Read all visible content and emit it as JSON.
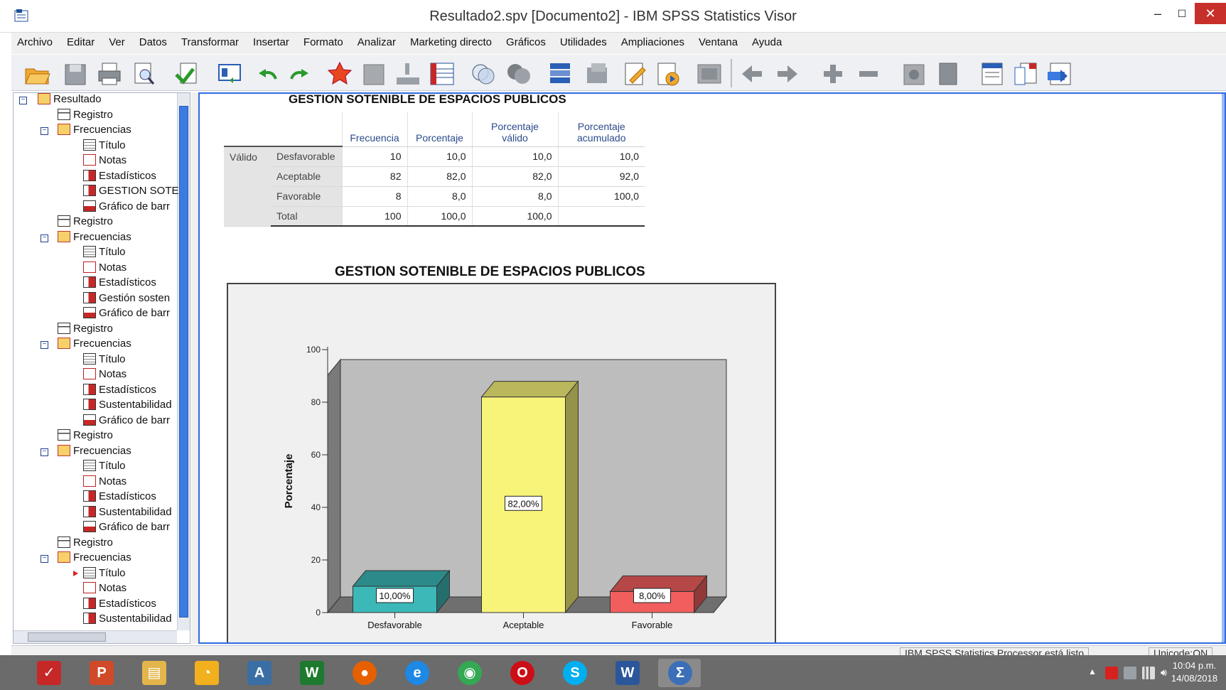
{
  "window": {
    "title": "Resultado2.spv [Documento2] - IBM SPSS Statistics Visor"
  },
  "menu": [
    "Archivo",
    "Editar",
    "Ver",
    "Datos",
    "Transformar",
    "Insertar",
    "Formato",
    "Analizar",
    "Marketing directo",
    "Gráficos",
    "Utilidades",
    "Ampliaciones",
    "Ventana",
    "Ayuda"
  ],
  "toolbar_icons": [
    "open-icon",
    "save-icon",
    "print-icon",
    "print-preview-icon",
    "export-icon",
    "recall-dialog-icon",
    "undo-icon",
    "redo-icon",
    "goto-data-icon",
    "goto-case-icon",
    "goto-variable-icon",
    "variables-icon",
    "run-descriptives-icon",
    "use-variable-sets-icon",
    "show-all-variables-icon",
    "spell-check-icon",
    "select-last-output-icon",
    "designate-window-icon",
    "create-edit-autoscript-icon",
    "run-script-icon",
    "outline-promote-icon",
    "outline-demote-icon",
    "expand-icon",
    "collapse-icon",
    "show-icon",
    "hide-icon",
    "insert-heading-icon",
    "insert-title-icon",
    "insert-text-icon"
  ],
  "outline": {
    "root": "Resultado",
    "groups": [
      {
        "registro": "Registro",
        "freq": "Frecuencias",
        "items": [
          "Título",
          "Notas",
          "Estadísticos",
          "GESTION SOTE",
          "Gráfico de barr"
        ]
      },
      {
        "registro": "Registro",
        "freq": "Frecuencias",
        "items": [
          "Título",
          "Notas",
          "Estadísticos",
          "Gestión sosten",
          "Gráfico de barr"
        ]
      },
      {
        "registro": "Registro",
        "freq": "Frecuencias",
        "items": [
          "Título",
          "Notas",
          "Estadísticos",
          "Sustentabilidad",
          "Gráfico de barr"
        ]
      },
      {
        "registro": "Registro",
        "freq": "Frecuencias",
        "items": [
          "Título",
          "Notas",
          "Estadísticos",
          "Sustentabilidad",
          "Gráfico de barr"
        ]
      },
      {
        "registro": "Registro",
        "freq": "Frecuencias",
        "items": [
          "Título",
          "Notas",
          "Estadísticos",
          "Sustentabilidad"
        ]
      }
    ]
  },
  "freq_table": {
    "title": "GESTION SOTENIBLE DE ESPACIOS PUBLICOS",
    "headers": [
      "Frecuencia",
      "Porcentaje",
      "Porcentaje válido",
      "Porcentaje acumulado"
    ],
    "group_label": "Válido",
    "rows": [
      {
        "label": "Desfavorable",
        "values": [
          "10",
          "10,0",
          "10,0",
          "10,0"
        ]
      },
      {
        "label": "Aceptable",
        "values": [
          "82",
          "82,0",
          "82,0",
          "92,0"
        ]
      },
      {
        "label": "Favorable",
        "values": [
          "8",
          "8,0",
          "8,0",
          "100,0"
        ]
      },
      {
        "label": "Total",
        "values": [
          "100",
          "100,0",
          "100,0",
          ""
        ]
      }
    ]
  },
  "chart_data": {
    "type": "bar",
    "title": "GESTION SOTENIBLE DE ESPACIOS PUBLICOS",
    "categories": [
      "Desfavorable",
      "Aceptable",
      "Favorable"
    ],
    "values": [
      10,
      82,
      8
    ],
    "data_labels": [
      "10,00%",
      "82,00%",
      "8,00%"
    ],
    "colors": [
      "#3cb8b8",
      "#f8f47a",
      "#f25e5e"
    ],
    "xlabel": "",
    "ylabel": "Porcentaje",
    "ylim": [
      0,
      100
    ],
    "yticks": [
      0,
      20,
      40,
      60,
      80,
      100
    ],
    "style": "3d",
    "grid": false
  },
  "status": {
    "processor": "IBM SPSS Statistics Processor está listo",
    "unicode": "Unicode:ON"
  },
  "taskbar": {
    "apps": [
      "taskbar-app-1",
      "powerpoint",
      "file-explorer",
      "dashboard",
      "app-a",
      "word-online",
      "firefox",
      "internet-explorer",
      "chrome",
      "opera",
      "skype",
      "word",
      "spss"
    ],
    "clock_time": "10:04 p.m.",
    "clock_date": "14/08/2018"
  },
  "colors": {
    "accent": "#2e6be0",
    "taskbar": "#6b6b6b",
    "close": "#c7302a"
  }
}
